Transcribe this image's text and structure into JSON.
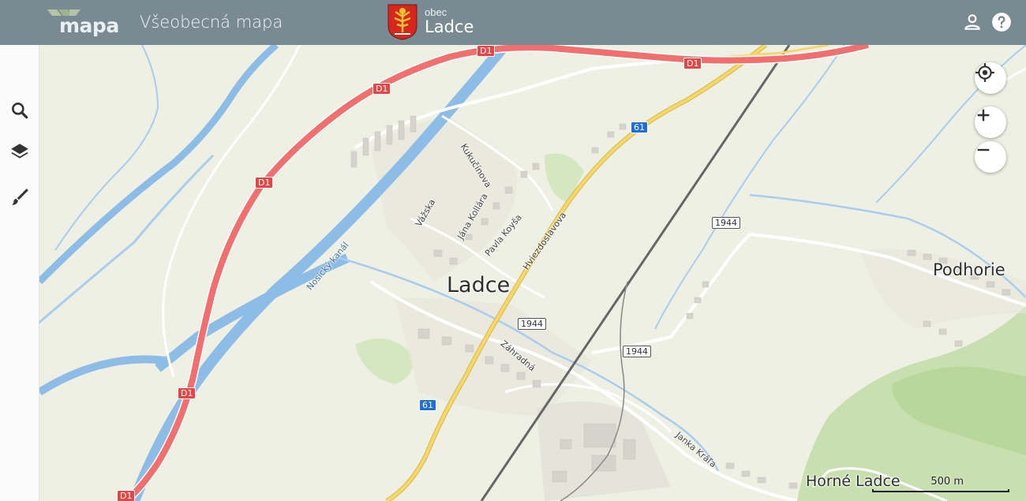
{
  "header": {
    "logo_text": "mapa",
    "app_title": "Všeobecná mapa",
    "municipality_label": "obec",
    "municipality_name": "Ladce",
    "account_icon": "account-icon",
    "help_icon": "help-icon"
  },
  "sidebar": {
    "items": [
      {
        "icon": "search-icon"
      },
      {
        "icon": "layers-icon"
      },
      {
        "icon": "brush-icon"
      }
    ]
  },
  "map_controls": {
    "locate_icon": "crosshair-icon",
    "zoom_in_icon": "plus-icon",
    "zoom_out_icon": "minus-icon"
  },
  "map": {
    "places": {
      "ladce": "Ladce",
      "podhorie": "Podhorie",
      "horne_ladce": "Horné Ladce"
    },
    "streets": {
      "kukucinova": "Kukučínova",
      "vazska": "Vážska",
      "jana_kollara": "Jána Kollára",
      "pavla_koysa": "Pavla Koyša",
      "hviezdoslavova": "Hviezdoslavova",
      "zahradna": "Záhradná",
      "janka_krala": "Janka Kráľa"
    },
    "canal": "Nosický kanál",
    "road_shields": {
      "d1": "D1",
      "r61": "61",
      "r1944": "1944"
    },
    "scale": "500 m"
  },
  "colors": {
    "header": "#7a8a93",
    "motorway": "#f07070",
    "river": "#8dbce6",
    "forest": "#c9e2b4",
    "road_primary": "#f4d35e",
    "railway": "#555555"
  }
}
